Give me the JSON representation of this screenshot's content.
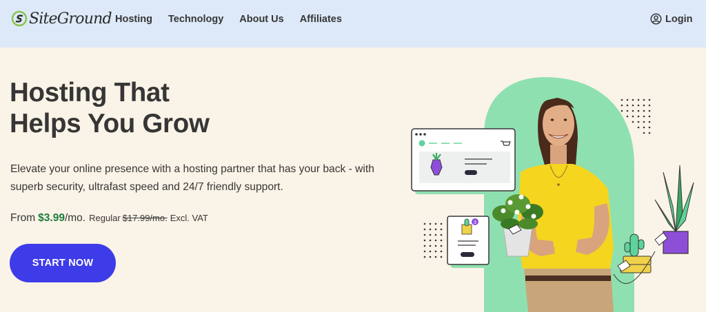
{
  "header": {
    "logo_text": "SiteGround",
    "nav": [
      {
        "label": "Hosting"
      },
      {
        "label": "Technology"
      },
      {
        "label": "About Us"
      },
      {
        "label": "Affiliates"
      }
    ],
    "login_label": "Login"
  },
  "hero": {
    "title_line1": "Hosting That",
    "title_line2": "Helps You Grow",
    "subtitle": "Elevate your online presence with a hosting partner that has your back - with superb security, ultrafast speed and 24/7 friendly support.",
    "price": {
      "from_label": "From",
      "amount": "$3.99",
      "per": "/mo.",
      "regular_label": "Regular",
      "regular_amount": "$17.99/mo.",
      "vat": "Excl. VAT"
    },
    "cta_label": "START NOW"
  },
  "illustration": {
    "card_badge_count": "3"
  },
  "colors": {
    "header_bg": "#dde9f8",
    "page_bg": "#faf3e7",
    "cta": "#3e3be8",
    "price_green": "#1a7e3b",
    "arch_green": "#8fe0b0",
    "logo_green": "#8bc34a"
  }
}
